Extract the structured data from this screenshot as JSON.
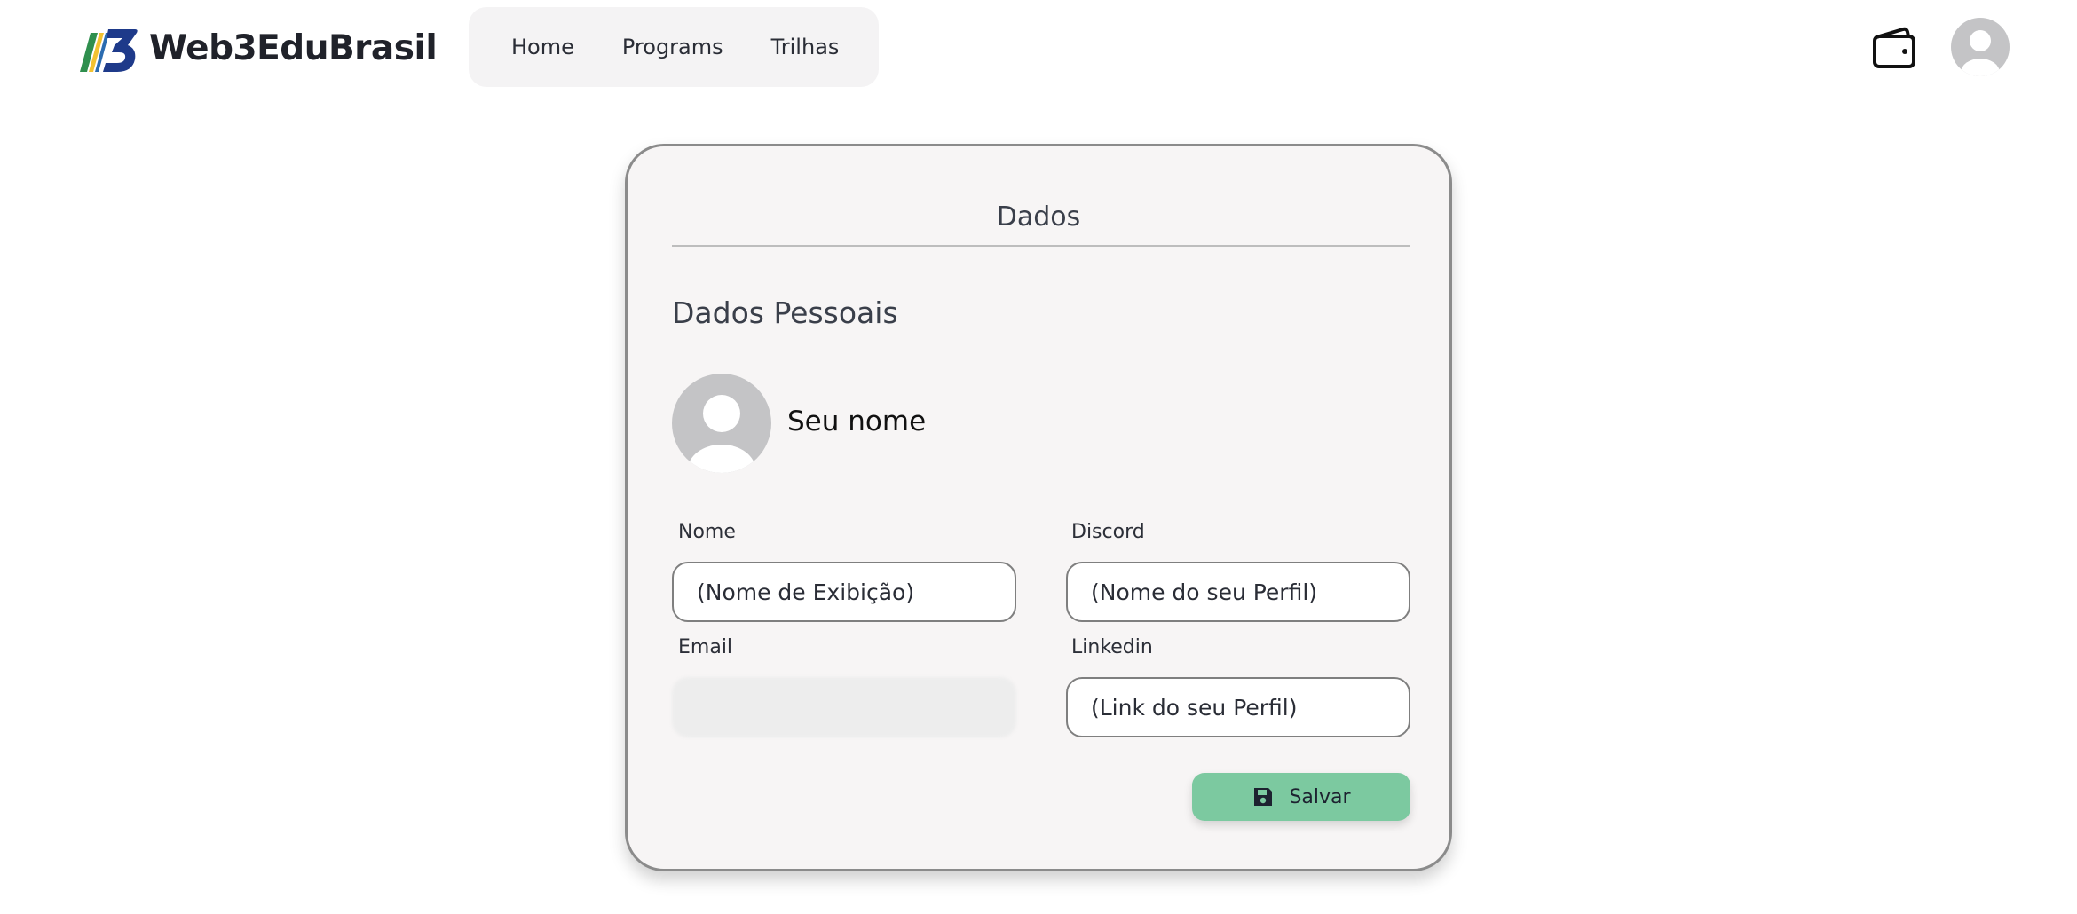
{
  "brand": {
    "name": "Web3EduBrasil",
    "logo_icon": "web3edubrasil-logo-icon"
  },
  "nav": {
    "items": [
      {
        "label": "Home"
      },
      {
        "label": "Programs"
      },
      {
        "label": "Trilhas"
      }
    ]
  },
  "header_actions": {
    "wallet_icon": "wallet-icon",
    "avatar_icon": "user-avatar-icon"
  },
  "card": {
    "title": "Dados",
    "section_title": "Dados Pessoais",
    "profile": {
      "display_name": "Seu nome",
      "avatar_icon": "user-avatar-icon"
    },
    "fields": {
      "nome": {
        "label": "Nome",
        "placeholder": "(Nome de Exibição)",
        "value": ""
      },
      "discord": {
        "label": "Discord",
        "placeholder": "(Nome do seu Perfil)",
        "value": ""
      },
      "email": {
        "label": "Email",
        "value": "",
        "state": "blurred"
      },
      "linkedin": {
        "label": "Linkedin",
        "placeholder": "(Link do seu Perfil)",
        "value": ""
      }
    },
    "save_button": {
      "label": "Salvar",
      "icon": "floppy-disk-icon"
    }
  },
  "colors": {
    "accent_green": "#7cc9a0",
    "card_background": "#f7f5f5",
    "nav_background": "#f4f3f4",
    "avatar_gray": "#c4c4c6"
  }
}
